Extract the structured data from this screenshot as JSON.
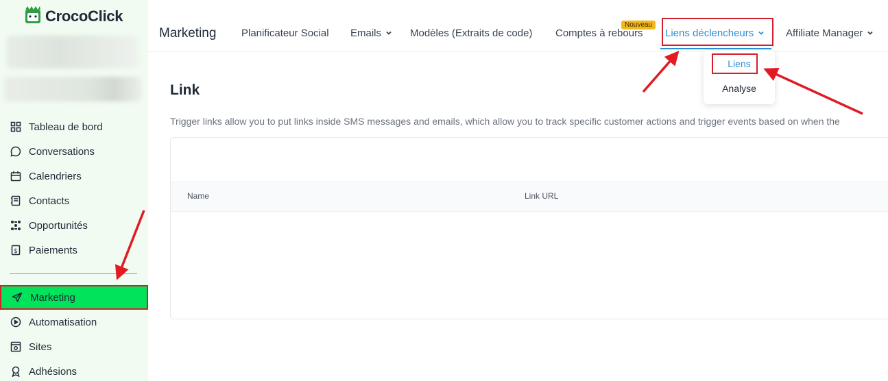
{
  "app": {
    "logo_text": "CrocoClick",
    "colors": {
      "accent": "#2b8fd6",
      "active_nav": "#00e35a",
      "annotation": "#d21f2b",
      "sidebar_bg": "#f1fbf1",
      "badge": "#f5b81b"
    }
  },
  "sidebar": {
    "items": [
      {
        "label": "Tableau de bord",
        "icon": "dashboard-icon"
      },
      {
        "label": "Conversations",
        "icon": "chat-icon"
      },
      {
        "label": "Calendriers",
        "icon": "calendar-icon"
      },
      {
        "label": "Contacts",
        "icon": "contacts-icon"
      },
      {
        "label": "Opportunités",
        "icon": "opportunities-icon"
      },
      {
        "label": "Paiements",
        "icon": "payments-icon"
      },
      {
        "label": "Marketing",
        "icon": "send-icon"
      },
      {
        "label": "Automatisation",
        "icon": "automation-icon"
      },
      {
        "label": "Sites",
        "icon": "sites-icon"
      },
      {
        "label": "Adhésions",
        "icon": "membership-icon"
      }
    ],
    "active": "Marketing"
  },
  "header": {
    "title": "Marketing",
    "tabs": [
      {
        "label": "Planificateur Social"
      },
      {
        "label": "Emails",
        "has_caret": true
      },
      {
        "label": "Modèles (Extraits de code)"
      },
      {
        "label": "Comptes à rebours",
        "badge": "Nouveau"
      },
      {
        "label": "Liens déclencheurs",
        "has_caret": true,
        "active": true
      },
      {
        "label": "Affiliate Manager",
        "has_caret": true
      }
    ]
  },
  "dropdown": {
    "items": [
      {
        "label": "Liens",
        "active": true
      },
      {
        "label": "Analyse"
      }
    ]
  },
  "main": {
    "heading": "Link",
    "description": "Trigger links allow you to put links inside SMS messages and emails, which allow you to track specific customer actions and trigger events based on when the",
    "table": {
      "columns": [
        "Name",
        "Link URL"
      ],
      "rows": []
    }
  }
}
